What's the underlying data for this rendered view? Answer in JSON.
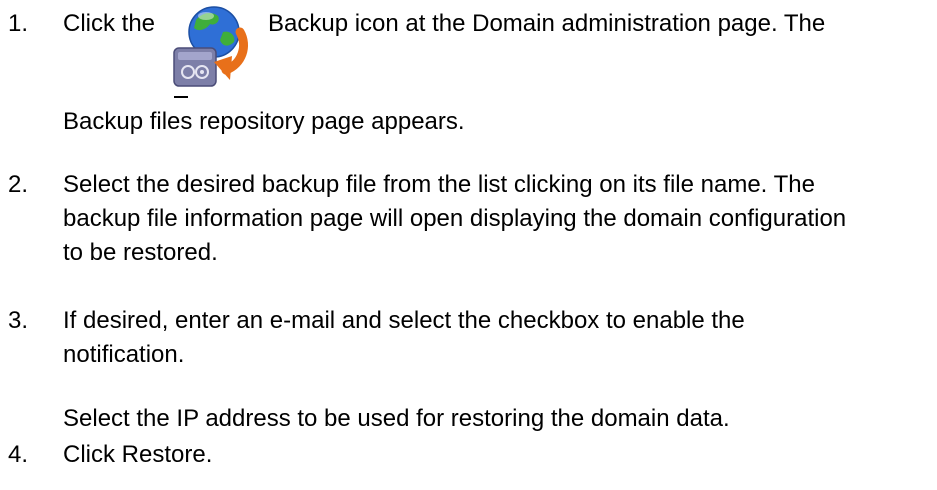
{
  "steps": [
    {
      "number": "1.",
      "pre_icon": "Click the",
      "icon": "backup-icon",
      "post_icon": "Backup icon at the Domain administration page. The",
      "continuation": "Backup files repository page appears."
    },
    {
      "number": "2.",
      "lines": [
        "Select the desired backup file from the list clicking on its file name. The",
        "backup file information page will open displaying the domain configuration",
        "to be restored."
      ]
    },
    {
      "number": "3.",
      "lines": [
        "If desired, enter an e-mail and select the checkbox to enable the",
        "notification."
      ],
      "extra": "Select the IP address to be used for restoring the domain data."
    },
    {
      "number": "4.",
      "lines": [
        "Click Restore."
      ]
    }
  ],
  "colors": {
    "text": "#000000",
    "globe_blue": "#2f6fd6",
    "globe_green": "#3fae3a",
    "arrow_orange": "#e8701a",
    "drive_gray": "#7d7fa8"
  }
}
